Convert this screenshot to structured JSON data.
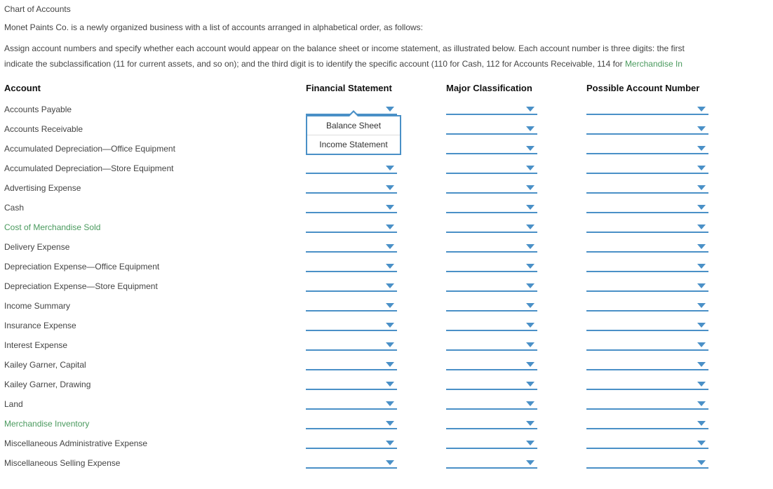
{
  "title": "Chart of Accounts",
  "intro": "Monet Paints Co. is a newly organized business with a list of accounts arranged in alphabetical order, as follows:",
  "instructions_part1": "Assign account numbers and specify whether each account would appear on the balance sheet or income statement, as illustrated below. Each account number is three digits: the first",
  "instructions_part2a": "indicate the subclassification (11 for current assets, and so on); and the third digit is to identify the specific account (110 for Cash, 112 for Accounts Receivable, 114 for ",
  "instructions_part2b": "Merchandise In",
  "headers": {
    "account": "Account",
    "fs": "Financial Statement",
    "mc": "Major Classification",
    "pan": "Possible Account Number"
  },
  "dropdown_options": {
    "fs": [
      "Balance Sheet",
      "Income Statement"
    ]
  },
  "accounts": [
    {
      "name": "Accounts Payable",
      "green": false,
      "open_dd": true
    },
    {
      "name": "Accounts Receivable",
      "green": false
    },
    {
      "name": "Accumulated Depreciation—Office Equipment",
      "green": false
    },
    {
      "name": "Accumulated Depreciation—Store Equipment",
      "green": false
    },
    {
      "name": "Advertising Expense",
      "green": false
    },
    {
      "name": "Cash",
      "green": false
    },
    {
      "name": "Cost of Merchandise Sold",
      "green": true
    },
    {
      "name": "Delivery Expense",
      "green": false
    },
    {
      "name": "Depreciation Expense—Office Equipment",
      "green": false
    },
    {
      "name": "Depreciation Expense—Store Equipment",
      "green": false
    },
    {
      "name": "Income Summary",
      "green": false
    },
    {
      "name": "Insurance Expense",
      "green": false
    },
    {
      "name": "Interest Expense",
      "green": false
    },
    {
      "name": "Kailey Garner, Capital",
      "green": false
    },
    {
      "name": "Kailey Garner, Drawing",
      "green": false
    },
    {
      "name": "Land",
      "green": false
    },
    {
      "name": "Merchandise Inventory",
      "green": true
    },
    {
      "name": "Miscellaneous Administrative Expense",
      "green": false
    },
    {
      "name": "Miscellaneous Selling Expense",
      "green": false
    }
  ]
}
